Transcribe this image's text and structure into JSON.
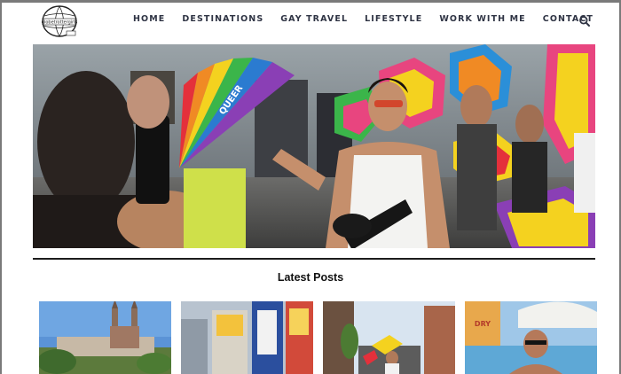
{
  "header": {
    "logo_text": "globetrottergirls",
    "nav": [
      {
        "label": "HOME"
      },
      {
        "label": "DESTINATIONS"
      },
      {
        "label": "GAY TRAVEL"
      },
      {
        "label": "LIFESTYLE"
      },
      {
        "label": "WORK WITH ME"
      },
      {
        "label": "CONTACT"
      }
    ],
    "search_icon": "search-icon"
  },
  "hero": {
    "alt": "Pride parade photo with a man holding a rainbow fan",
    "fan_text": "QUEER"
  },
  "latest": {
    "title": "Latest Posts",
    "posts": [
      {
        "thumb": "cathedral-city"
      },
      {
        "thumb": "dry-billboards"
      },
      {
        "thumb": "pride-street"
      },
      {
        "thumb": "pool-sunglasses",
        "sign": "DRY"
      }
    ]
  },
  "colors": {
    "nav_text": "#2f3444",
    "divider": "#1c1c1c",
    "rainbow": [
      "#e4303b",
      "#f08a24",
      "#f4d21f",
      "#3bb54a",
      "#2b7bd0",
      "#8a3fb5"
    ]
  }
}
